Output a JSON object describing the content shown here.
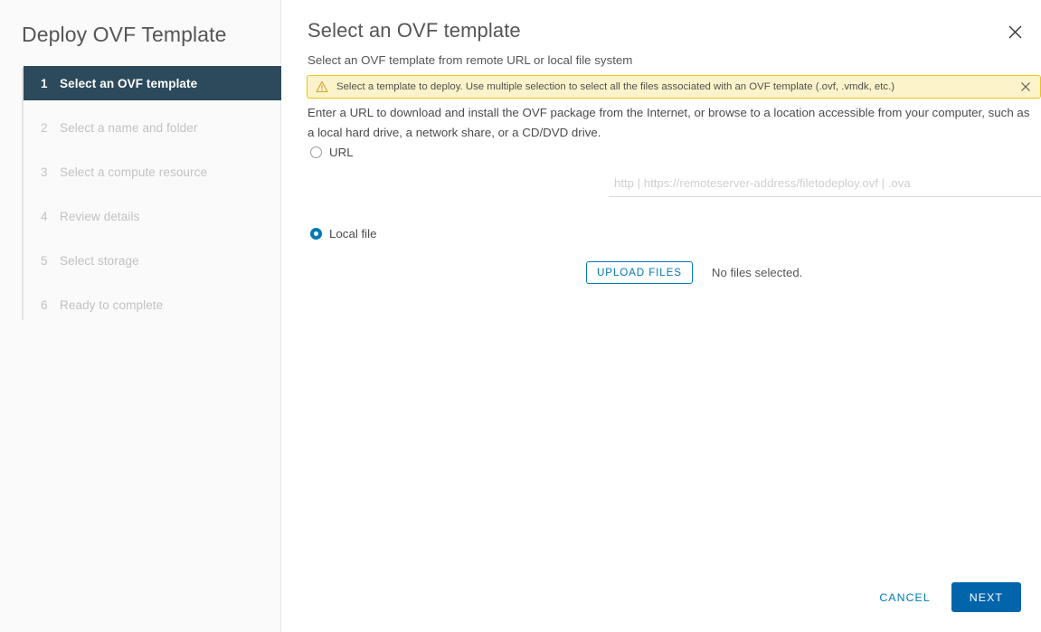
{
  "wizard": {
    "title": "Deploy OVF Template",
    "steps": [
      {
        "num": "1",
        "label": "Select an OVF template"
      },
      {
        "num": "2",
        "label": "Select a name and folder"
      },
      {
        "num": "3",
        "label": "Select a compute resource"
      },
      {
        "num": "4",
        "label": "Review details"
      },
      {
        "num": "5",
        "label": "Select storage"
      },
      {
        "num": "6",
        "label": "Ready to complete"
      }
    ]
  },
  "page": {
    "title": "Select an OVF template",
    "subtitle": "Select an OVF template from remote URL or local file system",
    "description": "Enter a URL to download and install the OVF package from the Internet, or browse to a location accessible from your computer, such as a local hard drive, a network share, or a CD/DVD drive."
  },
  "alert": {
    "text": "Select a template to deploy. Use multiple selection to select all the files associated with an OVF template (.ovf, .vmdk, etc.)",
    "icon": "warning-triangle-icon",
    "close_icon": "close-icon",
    "background_color": "#fdf3ca",
    "border_color": "#ecc317"
  },
  "source": {
    "url_option_label": "URL",
    "url_selected": false,
    "url_value": "",
    "url_placeholder": "http | https://remoteserver-address/filetodeploy.ovf | .ova",
    "local_option_label": "Local file",
    "local_selected": true,
    "upload_button_label": "UPLOAD FILES",
    "file_status": "No files selected."
  },
  "footer": {
    "cancel_label": "CANCEL",
    "next_label": "NEXT"
  },
  "colors": {
    "accent_blue": "#0079b8",
    "primary_button": "#0065ab",
    "active_step": "#2d4a5c",
    "sidebar_bg": "#fafafa"
  }
}
